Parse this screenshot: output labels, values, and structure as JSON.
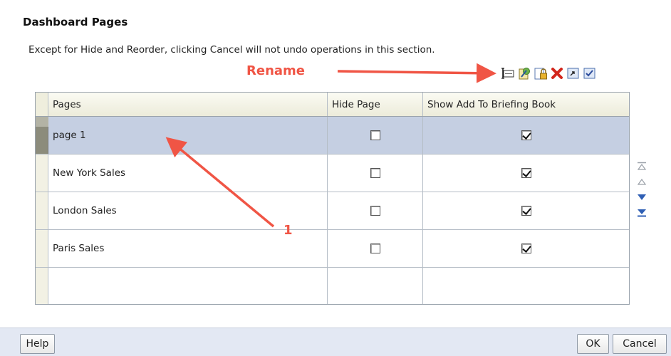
{
  "section": {
    "title": "Dashboard Pages",
    "note": "Except for Hide and Reorder, clicking Cancel will not undo operations in this section."
  },
  "annotation": {
    "rename_label": "Rename",
    "step_label": "1",
    "color": "#f05545"
  },
  "toolbar": {
    "icons": [
      "rename-icon",
      "permissions-icon",
      "lock-icon",
      "delete-icon",
      "export-icon",
      "select-icon"
    ]
  },
  "table": {
    "headers": {
      "pages": "Pages",
      "hide": "Hide Page",
      "show": "Show Add To Briefing Book"
    },
    "rows": [
      {
        "page": "page 1",
        "hide": false,
        "show": true,
        "selected": true
      },
      {
        "page": "New York Sales",
        "hide": false,
        "show": true,
        "selected": false
      },
      {
        "page": "London Sales",
        "hide": false,
        "show": true,
        "selected": false
      },
      {
        "page": "Paris Sales",
        "hide": false,
        "show": true,
        "selected": false
      }
    ]
  },
  "reorder": {
    "icons": [
      "move-top-icon",
      "move-up-icon",
      "move-down-icon",
      "move-bottom-icon"
    ]
  },
  "footer": {
    "help": "Help",
    "ok": "OK",
    "cancel": "Cancel"
  }
}
